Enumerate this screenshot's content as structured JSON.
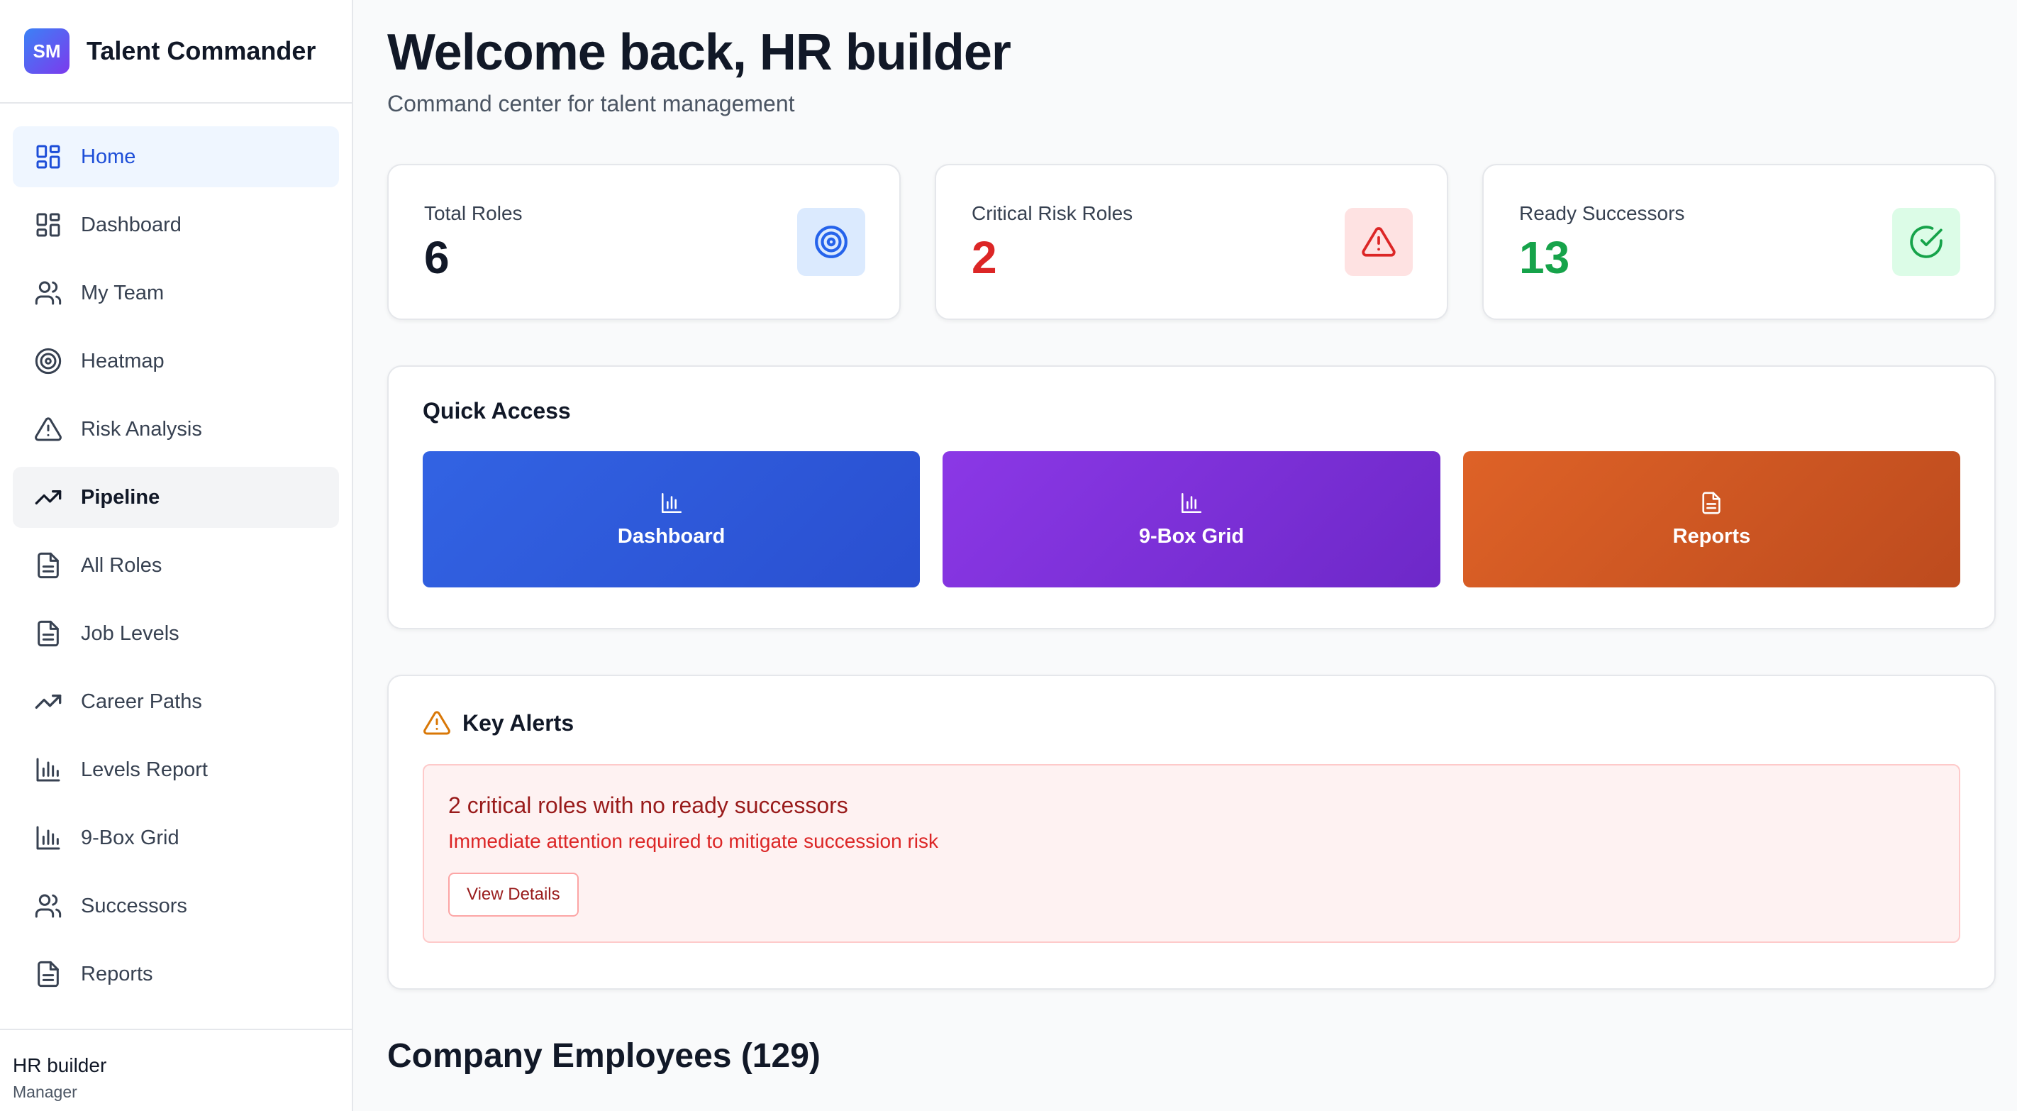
{
  "brand": {
    "initials": "SM",
    "name": "Talent Commander"
  },
  "nav": [
    {
      "label": "Home",
      "icon": "grid-icon"
    },
    {
      "label": "Dashboard",
      "icon": "grid-icon"
    },
    {
      "label": "My Team",
      "icon": "users-icon"
    },
    {
      "label": "Heatmap",
      "icon": "target-icon"
    },
    {
      "label": "Risk Analysis",
      "icon": "alert-triangle-icon"
    },
    {
      "label": "Pipeline",
      "icon": "trending-up-icon"
    },
    {
      "label": "All Roles",
      "icon": "document-icon"
    },
    {
      "label": "Job Levels",
      "icon": "document-icon"
    },
    {
      "label": "Career Paths",
      "icon": "trending-up-icon"
    },
    {
      "label": "Levels Report",
      "icon": "bar-chart-icon"
    },
    {
      "label": "9-Box Grid",
      "icon": "bar-chart-icon"
    },
    {
      "label": "Successors",
      "icon": "users-icon"
    },
    {
      "label": "Reports",
      "icon": "document-icon"
    }
  ],
  "user": {
    "name": "HR builder",
    "role": "Manager"
  },
  "header": {
    "title": "Welcome back, HR builder",
    "subtitle": "Command center for talent management"
  },
  "stats": [
    {
      "label": "Total Roles",
      "value": "6",
      "color": "#111827",
      "icon": "target-icon",
      "icon_bg": "#dbeafe",
      "icon_color": "#2563eb"
    },
    {
      "label": "Critical Risk Roles",
      "value": "2",
      "color": "#dc2626",
      "icon": "alert-triangle-icon",
      "icon_bg": "#fee2e2",
      "icon_color": "#dc2626"
    },
    {
      "label": "Ready Successors",
      "value": "13",
      "color": "#16a34a",
      "icon": "check-circle-icon",
      "icon_bg": "#dcfce7",
      "icon_color": "#16a34a"
    }
  ],
  "quick_access": {
    "title": "Quick Access",
    "items": [
      {
        "label": "Dashboard",
        "icon": "bar-chart-icon"
      },
      {
        "label": "9-Box Grid",
        "icon": "bar-chart-icon"
      },
      {
        "label": "Reports",
        "icon": "document-icon"
      }
    ]
  },
  "alerts": {
    "title": "Key Alerts",
    "items": [
      {
        "title": "2 critical roles with no ready successors",
        "message": "Immediate attention required to mitigate succession risk",
        "action": "View Details"
      }
    ]
  },
  "employees": {
    "title": "Company Employees (129)"
  },
  "colors": {
    "accent": "#2563eb",
    "danger": "#dc2626",
    "success": "#16a34a",
    "warning": "#d97706"
  }
}
